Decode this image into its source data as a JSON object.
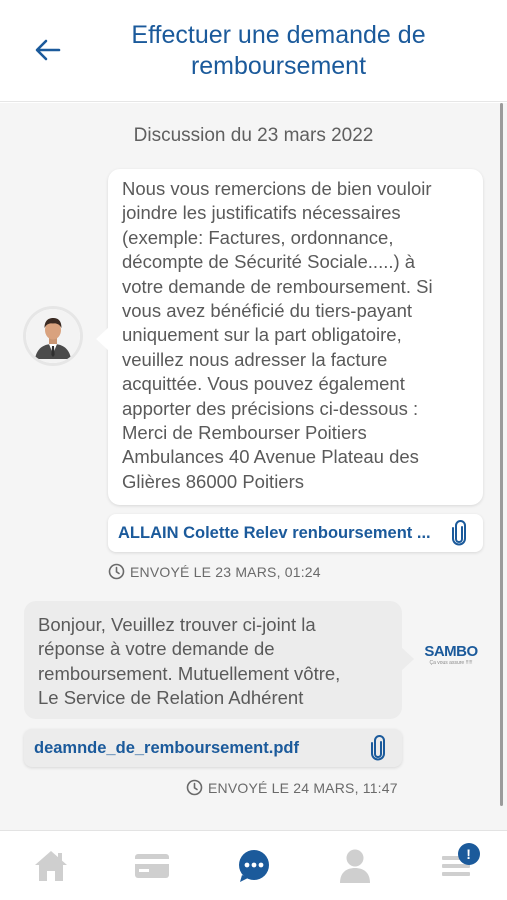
{
  "header": {
    "title_line1": "Effectuer une demande de",
    "title_line2": "remboursement"
  },
  "conversation": {
    "date_label": "Discussion du 23 mars 2022",
    "messages": [
      {
        "direction": "incoming",
        "lines": [
          "Nous vous remercions de bien vouloir",
          "joindre les justificatifs nécessaires",
          "(exemple: Factures, ordonnance,",
          "décompte de Sécurité Sociale.....) à",
          "votre demande de remboursement. Si",
          "vous avez bénéficié du tiers-payant",
          "uniquement sur la part obligatoire,",
          "veuillez nous adresser la facture",
          "acquittée. Vous pouvez également",
          "apporter des précisions ci-dessous :",
          "Merci de Rembourser Poitiers",
          "Ambulances 40 Avenue Plateau des",
          "Glières 86000 Poitiers"
        ],
        "attachment": "ALLAIN Colette Relev renboursement ...",
        "status": "ENVOYÉ LE 23 MARS, 01:24"
      },
      {
        "direction": "outgoing",
        "lines": [
          "Bonjour, Veuillez trouver ci-joint la",
          "réponse à votre demande de",
          "remboursement. Mutuellement vôtre,",
          "Le Service de Relation Adhérent"
        ],
        "attachment": "deamnde_de_remboursement.pdf",
        "status": "ENVOYÉ LE 24 MARS, 11:47",
        "logo_text": "SAMBO",
        "logo_tagline": "Ça vous assure !!!!!"
      }
    ]
  },
  "tabbar": {
    "items": [
      {
        "icon": "home-icon",
        "active": false
      },
      {
        "icon": "card-icon",
        "active": false
      },
      {
        "icon": "chat-icon",
        "active": true
      },
      {
        "icon": "profile-icon",
        "active": false
      },
      {
        "icon": "menu-icon",
        "active": false,
        "badge": "!"
      }
    ]
  },
  "colors": {
    "accent": "#1b5a9b",
    "icon_inactive": "#cfcfcf",
    "background": "#f5f5f5"
  }
}
